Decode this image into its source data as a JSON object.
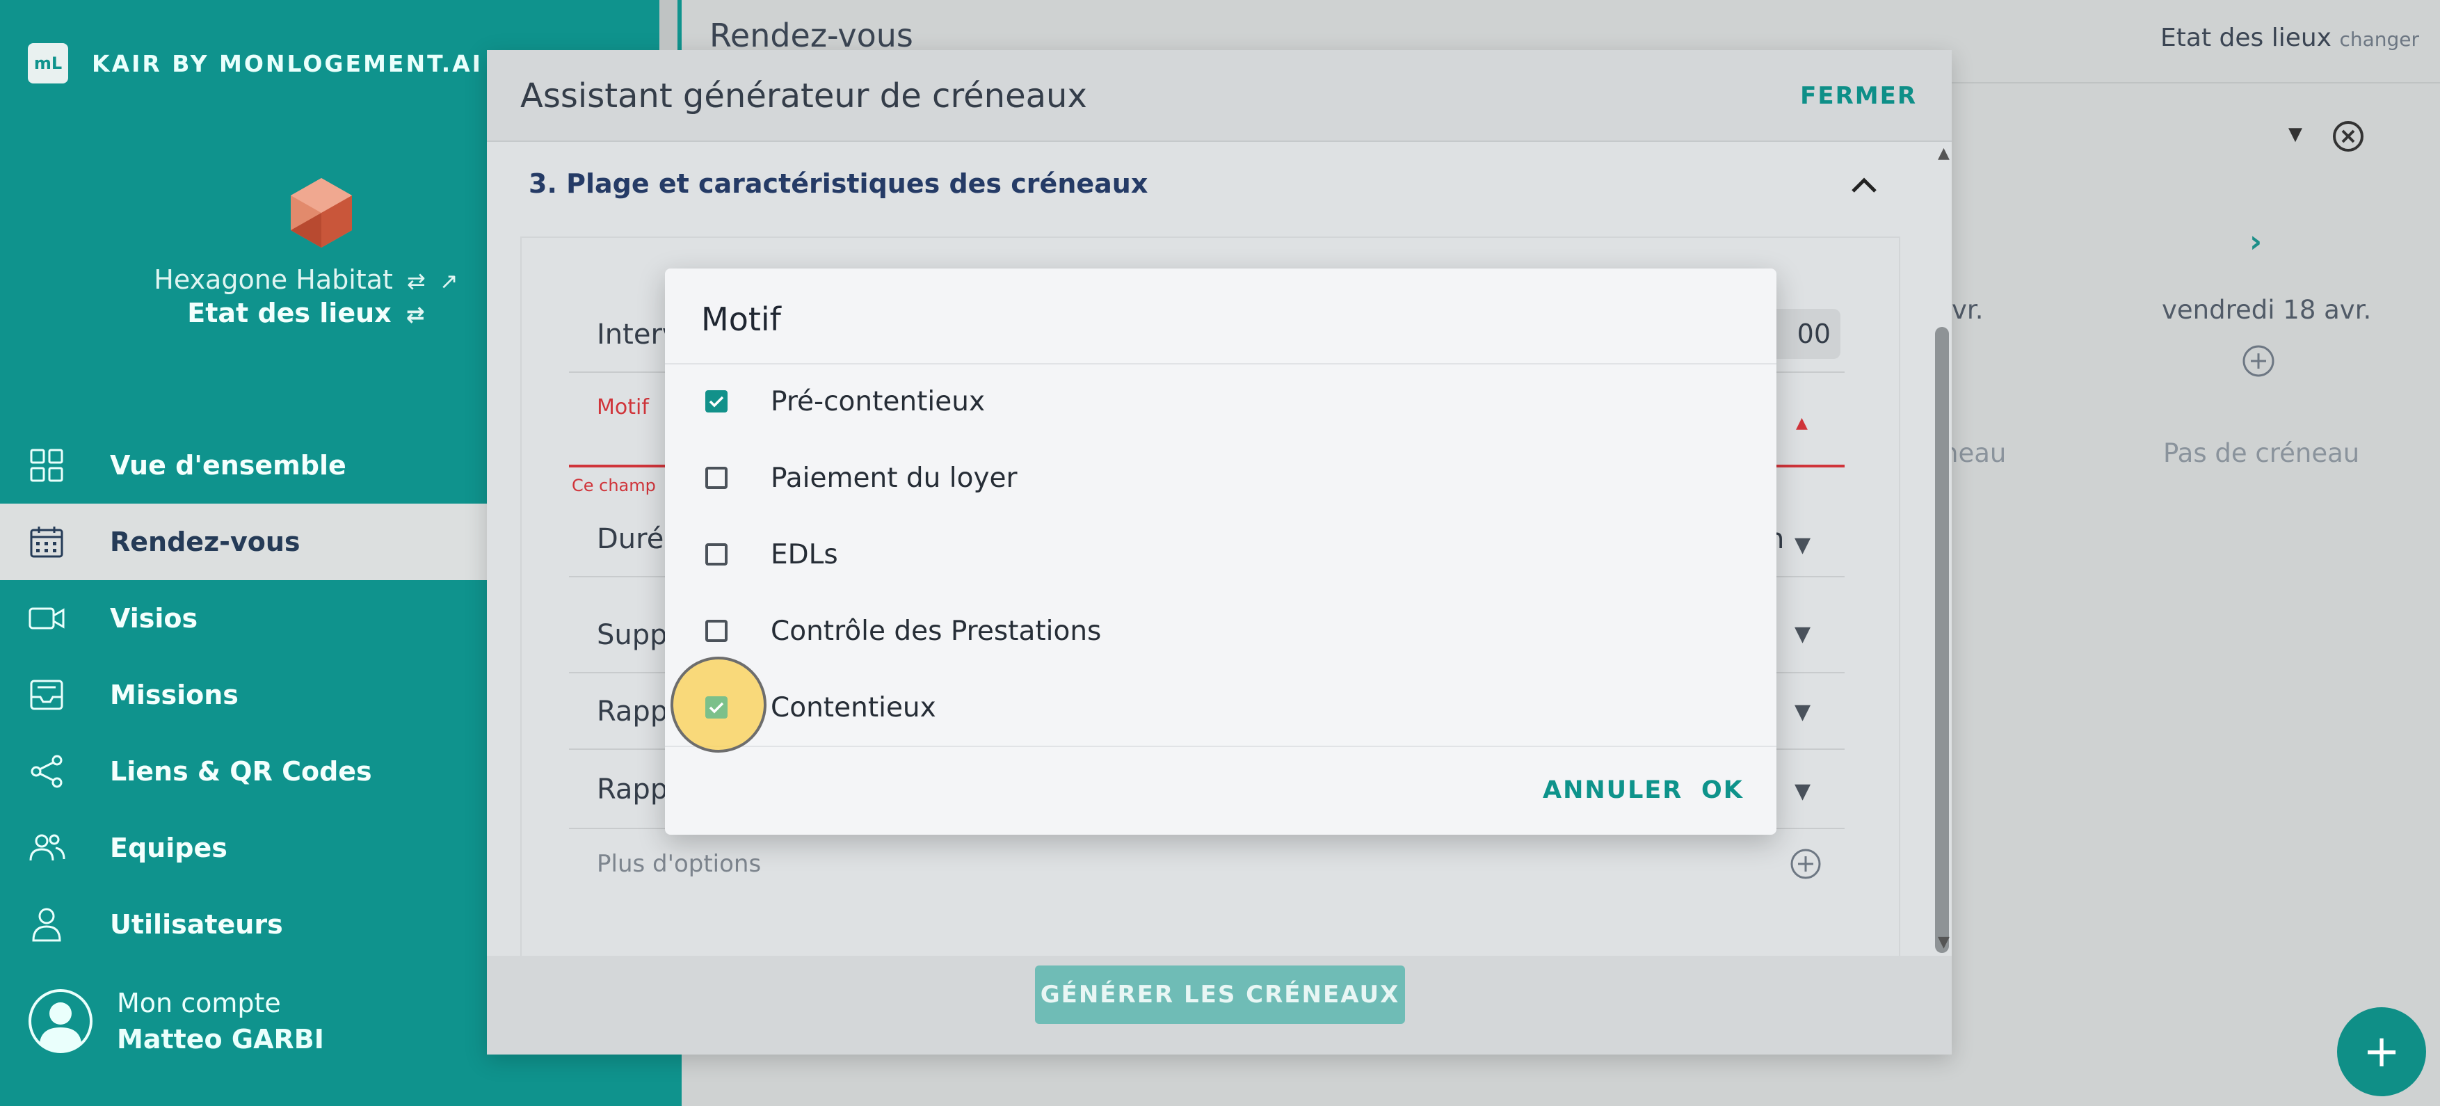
{
  "brand": {
    "logo": "mL",
    "name": "KAIR BY MONLOGEMENT.AI"
  },
  "organization": {
    "name": "Hexagone Habitat",
    "module": "Etat des lieux"
  },
  "nav": [
    {
      "label": "Vue d'ensemble",
      "icon": "grid-icon"
    },
    {
      "label": "Rendez-vous",
      "icon": "calendar-icon",
      "active": true
    },
    {
      "label": "Visios",
      "icon": "video-icon"
    },
    {
      "label": "Missions",
      "icon": "inbox-icon"
    },
    {
      "label": "Liens & QR Codes",
      "icon": "share-icon"
    },
    {
      "label": "Equipes",
      "icon": "team-icon"
    },
    {
      "label": "Utilisateurs",
      "icon": "user-icon"
    }
  ],
  "account": {
    "label": "Mon compte",
    "name": "Matteo GARBI"
  },
  "page": {
    "title": "Rendez-vous",
    "context": "Etat des lieux",
    "context_action": "changer",
    "calendar": {
      "col1_day_partial": "vr.",
      "col1_empty_partial": "neau",
      "col2_day": "vendredi 18 avr.",
      "col2_empty": "Pas de créneau"
    }
  },
  "wizard": {
    "title": "Assistant générateur de créneaux",
    "close": "FERMER",
    "section_title": "3. Plage et caractéristiques des créneaux",
    "rows": {
      "interval": "Interv",
      "interval_value": "00",
      "motif": "Motif",
      "motif_error": "Ce champ",
      "duree": "Durée",
      "duree_value": "n",
      "supp": "Supp",
      "rapp1": "Rapp",
      "rapp2": "Rapp",
      "more": "Plus d'options"
    },
    "generate": "GÉNÉRER LES CRÉNEAUX"
  },
  "dialog": {
    "title": "Motif",
    "options": [
      {
        "label": "Pré-contentieux",
        "checked": true
      },
      {
        "label": "Paiement du loyer",
        "checked": false
      },
      {
        "label": "EDLs",
        "checked": false
      },
      {
        "label": "Contrôle des Prestations",
        "checked": false
      },
      {
        "label": "Contentieux",
        "checked": true
      }
    ],
    "cancel": "ANNULER",
    "ok": "OK"
  },
  "colors": {
    "teal": "#0f938d",
    "navy": "#253b66",
    "error": "#d0343a",
    "highlight": "#fad25a"
  }
}
